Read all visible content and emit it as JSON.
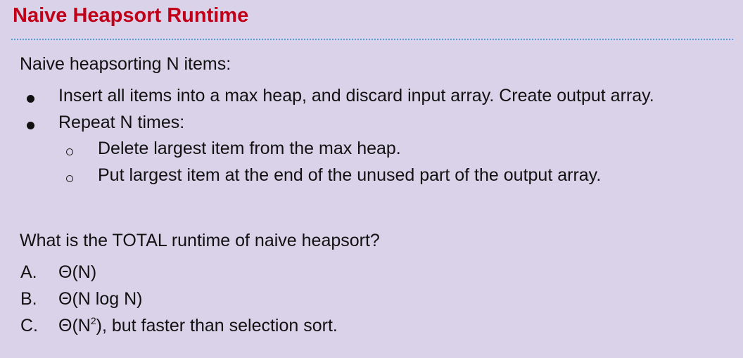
{
  "title": "Naive Heapsort Runtime",
  "intro": "Naive heapsorting N items:",
  "bullets": [
    "Insert all items into a max heap, and discard input array. Create output array.",
    "Repeat N times:"
  ],
  "sub_bullets": [
    "Delete largest item from the max heap.",
    "Put largest item at the end of the unused part of the output array."
  ],
  "question": "What is the TOTAL runtime of naive heapsort?",
  "choices": [
    {
      "letter": "A.",
      "text": "Θ(N)"
    },
    {
      "letter": "B.",
      "text": "Θ(N log N)"
    },
    {
      "letter": "C.",
      "pre": "Θ(N",
      "sup": "2",
      "post": "), but faster than selection sort."
    }
  ]
}
